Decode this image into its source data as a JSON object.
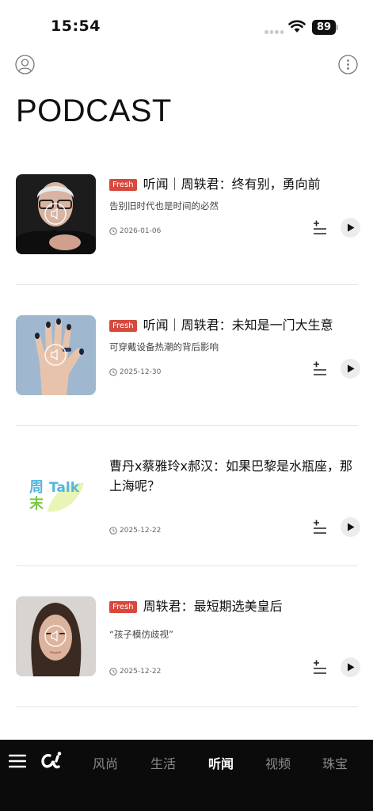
{
  "status_bar": {
    "time": "15:54",
    "battery": "89"
  },
  "header": {
    "title": "PODCAST",
    "avatar_icon": "user-circle-icon",
    "more_icon": "more-vertical-icon"
  },
  "items": [
    {
      "badge": "Fresh",
      "title": "听闻｜周轶君：终有别，勇向前",
      "subtitle": "告别旧时代也是时间的必然",
      "date": "2026-01-06"
    },
    {
      "badge": "Fresh",
      "title": "听闻｜周轶君：未知是一门大生意",
      "subtitle": "可穿戴设备热潮的背后影响",
      "date": "2025-12-30"
    },
    {
      "badge": "",
      "title": "曹丹x蔡雅玲x郝汉：如果巴黎是水瓶座，那上海呢？",
      "subtitle": "",
      "date": "2025-12-22",
      "logo_text": [
        "周",
        "末",
        "Talk"
      ]
    },
    {
      "badge": "Fresh",
      "title": "周轶君：最短期选美皇后",
      "subtitle": "“孩子模仿歧视”",
      "date": "2025-12-22"
    }
  ],
  "bottom_nav": {
    "tabs": [
      {
        "label": "风尚"
      },
      {
        "label": "生活"
      },
      {
        "label": "听闻"
      },
      {
        "label": "视频"
      },
      {
        "label": "珠宝"
      }
    ],
    "active_index": 2
  },
  "colors": {
    "badge": "#d6493c",
    "nav_bg": "#0b0b0b",
    "nav_active": "#ffffff",
    "nav_inactive": "#8a8a8a"
  }
}
